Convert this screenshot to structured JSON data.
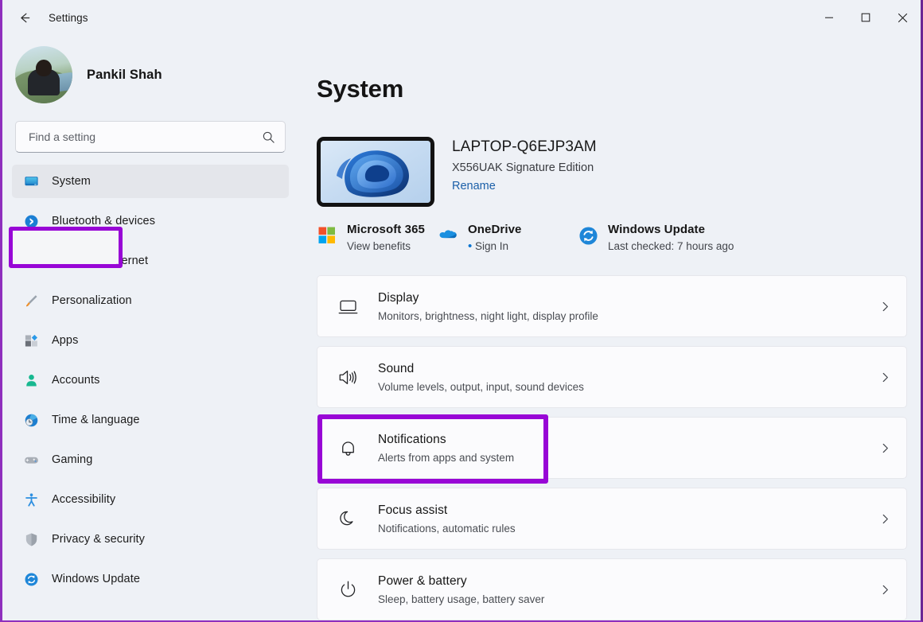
{
  "window": {
    "title": "Settings",
    "back_icon": "back-arrow-icon",
    "controls": {
      "minimize": "minimize-icon",
      "maximize": "maximize-icon",
      "close": "close-icon"
    }
  },
  "sidebar": {
    "profile": {
      "name": "Pankil Shah",
      "avatar": "user-avatar"
    },
    "search": {
      "placeholder": "Find a setting",
      "value": "",
      "icon": "search-icon"
    },
    "items": [
      {
        "label": "System",
        "icon": "monitor-icon",
        "selected": true
      },
      {
        "label": "Bluetooth & devices",
        "icon": "bluetooth-icon",
        "selected": false
      },
      {
        "label": "Network & internet",
        "icon": "wifi-icon",
        "selected": false
      },
      {
        "label": "Personalization",
        "icon": "paintbrush-icon",
        "selected": false
      },
      {
        "label": "Apps",
        "icon": "apps-icon",
        "selected": false
      },
      {
        "label": "Accounts",
        "icon": "person-icon",
        "selected": false
      },
      {
        "label": "Time & language",
        "icon": "clock-globe-icon",
        "selected": false
      },
      {
        "label": "Gaming",
        "icon": "gamepad-icon",
        "selected": false
      },
      {
        "label": "Accessibility",
        "icon": "accessibility-icon",
        "selected": false
      },
      {
        "label": "Privacy & security",
        "icon": "shield-icon",
        "selected": false
      },
      {
        "label": "Windows Update",
        "icon": "update-refresh-icon",
        "selected": false
      }
    ]
  },
  "main": {
    "page_title": "System",
    "device": {
      "name": "LAPTOP-Q6EJP3AM",
      "model": "X556UAK Signature Edition",
      "rename_label": "Rename",
      "thumbnail": "windows-bloom-wallpaper"
    },
    "quick_links": [
      {
        "title": "Microsoft 365",
        "sub": "View benefits",
        "icon": "microsoft-logo-icon",
        "has_dot": false
      },
      {
        "title": "OneDrive",
        "sub": "Sign In",
        "icon": "onedrive-cloud-icon",
        "has_dot": true
      },
      {
        "title": "Windows Update",
        "sub": "Last checked: 7 hours ago",
        "icon": "update-refresh-icon",
        "has_dot": false
      }
    ],
    "settings_cards": [
      {
        "title": "Display",
        "sub": "Monitors, brightness, night light, display profile",
        "icon": "monitor-outline-icon",
        "highlighted": false
      },
      {
        "title": "Sound",
        "sub": "Volume levels, output, input, sound devices",
        "icon": "speaker-icon",
        "highlighted": false
      },
      {
        "title": "Notifications",
        "sub": "Alerts from apps and system",
        "icon": "bell-icon",
        "highlighted": true
      },
      {
        "title": "Focus assist",
        "sub": "Notifications, automatic rules",
        "icon": "moon-icon",
        "highlighted": false
      },
      {
        "title": "Power & battery",
        "sub": "Sleep, battery usage, battery saver",
        "icon": "power-icon",
        "highlighted": false
      }
    ]
  },
  "annotations": {
    "highlight_color": "#9806d6",
    "targets": [
      "System",
      "Notifications"
    ]
  }
}
